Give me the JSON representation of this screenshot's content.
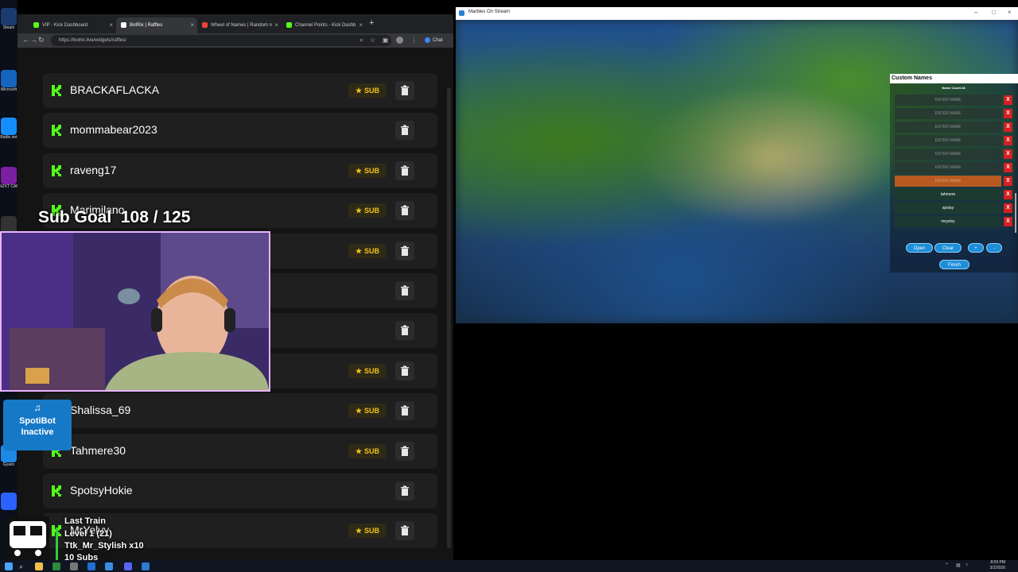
{
  "desktop": {
    "icons": [
      {
        "label": "Steam",
        "color": "#1b3b6f"
      },
      {
        "label": "Microsoft",
        "color": "#1565c0"
      },
      {
        "label": "Battle.net",
        "color": "#148eff"
      },
      {
        "label": "NZXT CAM",
        "color": "#7b1fa2"
      },
      {
        "label": "",
        "color": "#333333"
      },
      {
        "label": "",
        "color": "#2f6fd1"
      },
      {
        "label": "Gyazo",
        "color": "#1e88e5"
      },
      {
        "label": "",
        "color": "#2962ff"
      }
    ]
  },
  "browser": {
    "tabs": [
      {
        "label": "VIP - Kick Dashboard",
        "icon_color": "#53fc18"
      },
      {
        "label": "BotRix | Raffles",
        "icon_color": "#ffffff"
      },
      {
        "label": "Wheel of Names | Random n",
        "icon_color": "#ea4335"
      },
      {
        "label": "Channel Points - Kick Dashb",
        "icon_color": "#53fc18"
      }
    ],
    "new_tab": "+",
    "url": "https://botrix.live/widgets/raffles/",
    "chat_label": "Chat",
    "raffle_entries": [
      {
        "name": "BRACKAFLACKA",
        "sub": true
      },
      {
        "name": "mommabear2023",
        "sub": false
      },
      {
        "name": "raveng17",
        "sub": true
      },
      {
        "name": "Marimilano",
        "sub": true
      },
      {
        "name": "",
        "sub": true
      },
      {
        "name": "",
        "sub": false
      },
      {
        "name": "",
        "sub": false
      },
      {
        "name": "",
        "sub": true
      },
      {
        "name": "Shalissa_69",
        "sub": true
      },
      {
        "name": "Tahmere30",
        "sub": true
      },
      {
        "name": "SpotsyHokie",
        "sub": false
      },
      {
        "name": "MrYelvy",
        "sub": true
      }
    ],
    "sub_label": "SUB",
    "star": "★"
  },
  "overlay": {
    "sub_goal": "Sub Goal  108 / 125",
    "spotibot_line1": "SpotiBot",
    "spotibot_line2": "Inactive",
    "last_train": "Last Train",
    "train_level": "Level 1  (21)",
    "train_gift": "Ttk_Mr_Stylish x10",
    "train_subs": "10 Subs"
  },
  "marbles": {
    "window_title": "Marbles On Stream",
    "panel_title": "Custom Names",
    "name_count": "Name Count:48",
    "name_rows": [
      {
        "text": "ENTER NAME",
        "state": "empty"
      },
      {
        "text": "ENTER NAME",
        "state": "empty"
      },
      {
        "text": "ENTER NAME",
        "state": "empty"
      },
      {
        "text": "ENTER NAME",
        "state": "empty"
      },
      {
        "text": "ENTER NAME",
        "state": "empty"
      },
      {
        "text": "ENTER NAME",
        "state": "empty"
      },
      {
        "text": "ENTER NAME",
        "state": "highlight"
      },
      {
        "text": "tahmere",
        "state": "filled"
      },
      {
        "text": "spotsy",
        "state": "filled"
      },
      {
        "text": "mryelvy",
        "state": "filled"
      }
    ],
    "x_label": "X",
    "btn_open": "Open",
    "btn_clear": "Clear",
    "btn_plus": "+",
    "btn_minus": "-",
    "btn_finish": "Finish"
  },
  "taskbar": {
    "time": "8:59 PM",
    "date": "3/2/2026"
  }
}
